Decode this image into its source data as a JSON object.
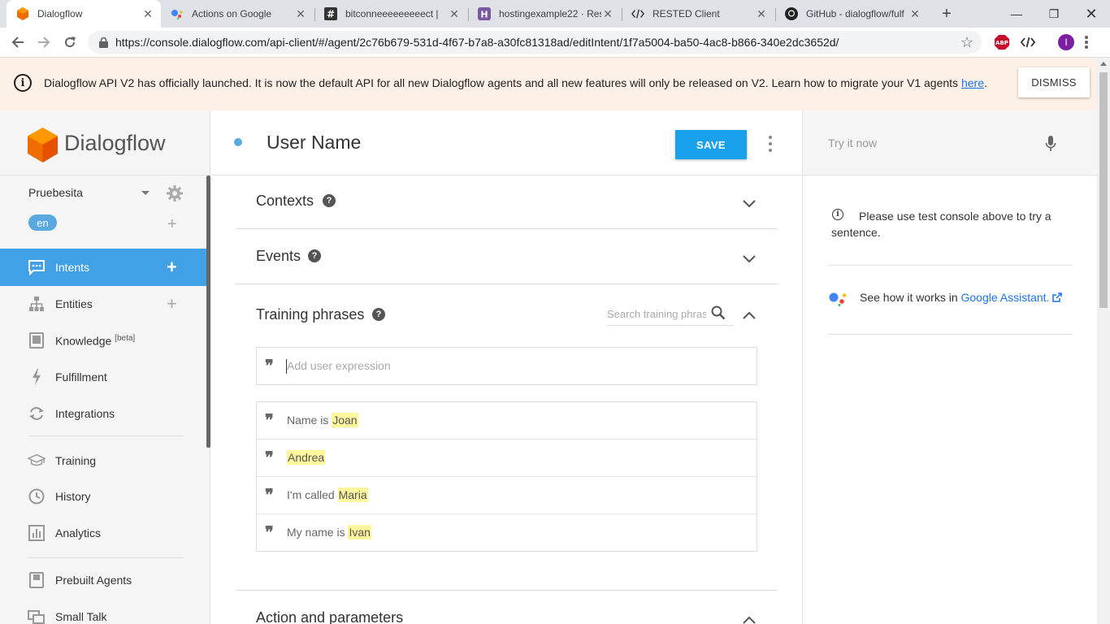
{
  "browser": {
    "tabs": [
      {
        "title": "Dialogflow",
        "active": true
      },
      {
        "title": "Actions on Google",
        "active": false
      },
      {
        "title": "bitconneeeeeeeeect | ",
        "active": false
      },
      {
        "title": "hostingexample22 · Res",
        "active": false
      },
      {
        "title": "RESTED Client",
        "active": false
      },
      {
        "title": "GitHub - dialogflow/fulf",
        "active": false
      }
    ],
    "url": "https://console.dialogflow.com/api-client/#/agent/2c76b679-531d-4f67-b7a8-a30fc81318ad/editIntent/1f7a5004-ba50-4ac8-b866-340e2dc3652d/",
    "profile_initial": "I",
    "abp_label": "ABP"
  },
  "banner": {
    "text": "Dialogflow API V2 has officially launched. It is now the default API for all new Dialogflow agents and all new features will only be released on V2. Learn how to migrate your V1 agents ",
    "link": "here",
    "suffix": ".",
    "dismiss_label": "DISMISS"
  },
  "sidebar": {
    "logo_text": "Dialogflow",
    "agent_name": "Pruebesita",
    "language": "en",
    "items": [
      {
        "label": "Intents"
      },
      {
        "label": "Entities"
      },
      {
        "label": "Knowledge",
        "badge": "[beta]"
      },
      {
        "label": "Fulfillment"
      },
      {
        "label": "Integrations"
      },
      {
        "label": "Training"
      },
      {
        "label": "History"
      },
      {
        "label": "Analytics"
      },
      {
        "label": "Prebuilt Agents"
      },
      {
        "label": "Small Talk"
      }
    ]
  },
  "intent": {
    "name": "User Name",
    "save_label": "SAVE",
    "sections": {
      "contexts": "Contexts",
      "events": "Events",
      "training": "Training phrases",
      "action": "Action and parameters"
    },
    "search_placeholder": "Search training phrases",
    "add_expression_placeholder": "Add user expression",
    "phrases": [
      {
        "prefix": "Name is ",
        "entity": "Joan"
      },
      {
        "prefix": "",
        "entity": "Andrea"
      },
      {
        "prefix": "I'm called ",
        "entity": "Maria"
      },
      {
        "prefix": "My name is ",
        "entity": "Ivan"
      }
    ]
  },
  "right_panel": {
    "try_placeholder": "Try it now",
    "info_text": "Please use test console above to try a sentence.",
    "ga_prefix": "See how it works in ",
    "ga_link": "Google Assistant."
  },
  "colors": {
    "accent": "#41a0e6",
    "save": "#1aa1ec",
    "banner_bg": "#fdf0e6",
    "highlight": "#fff59d"
  }
}
